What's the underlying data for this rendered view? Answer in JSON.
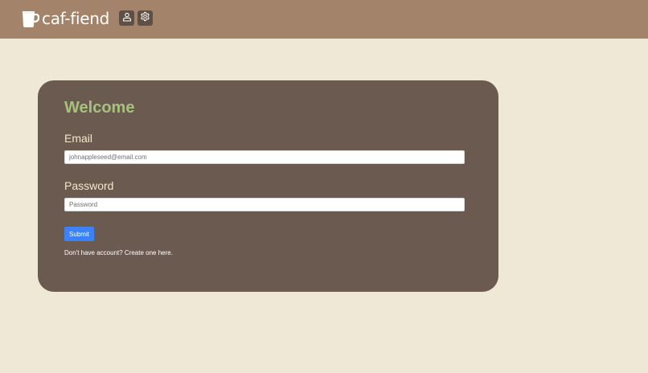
{
  "header": {
    "brand": "caf-fiend",
    "icons": [
      "coffee-mug-icon",
      "user-icon",
      "gear-icon"
    ]
  },
  "login": {
    "title": "Welcome",
    "email_label": "Email",
    "email_placeholder": "johnappleseed@email.com",
    "password_label": "Password",
    "password_placeholder": "Password",
    "submit_label": "Submit",
    "signup_text": "Don't have account? Create one here."
  },
  "colors": {
    "header_bg": "#a3846a",
    "page_bg": "#efe8d6",
    "card_bg": "#6b5a4f",
    "title": "#a6c17e",
    "label": "#f2e8c9",
    "button": "#3b82f6"
  }
}
